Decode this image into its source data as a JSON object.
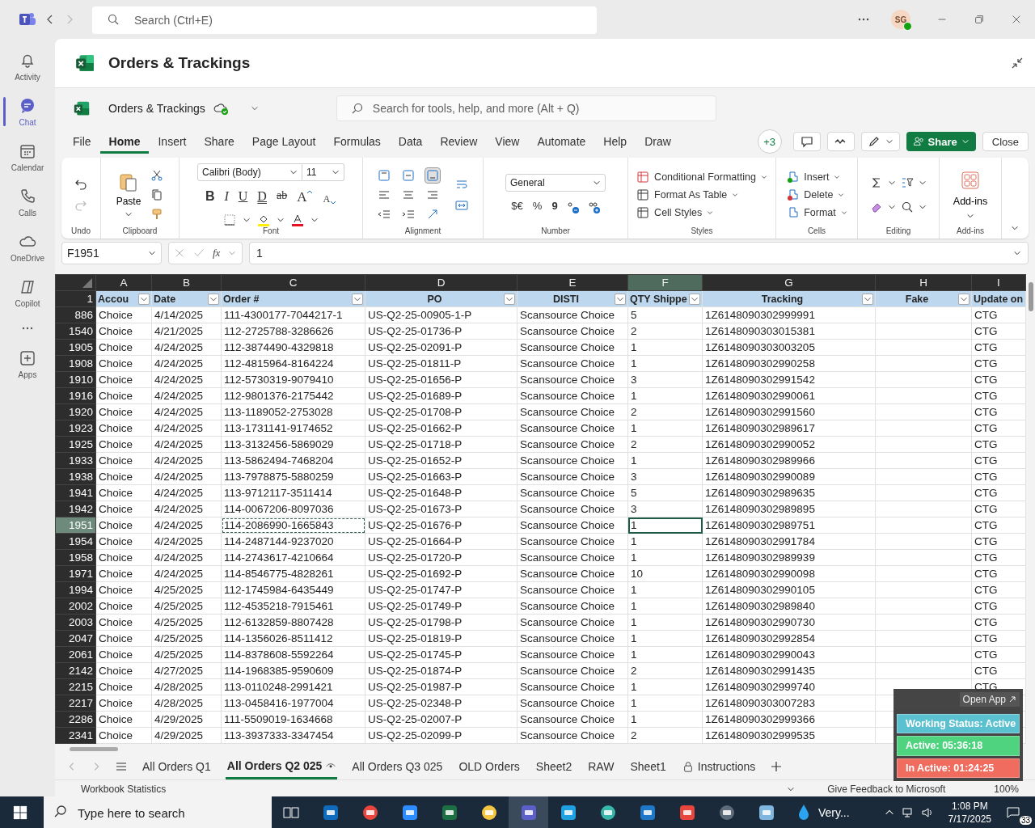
{
  "top_bar": {
    "search_placeholder": "Search (Ctrl+E)",
    "avatar_initials": "SG",
    "online": true
  },
  "sidebar": {
    "items": [
      {
        "label": "Activity",
        "selected": false
      },
      {
        "label": "Chat",
        "selected": true
      },
      {
        "label": "Calendar",
        "selected": false
      },
      {
        "label": "Calls",
        "selected": false
      },
      {
        "label": "OneDrive",
        "selected": false
      },
      {
        "label": "Copilot",
        "selected": false
      },
      {
        "label": "Apps",
        "selected": false
      }
    ]
  },
  "app_header": {
    "title": "Orders & Trackings"
  },
  "workbook": {
    "name": "Orders & Trackings",
    "search_placeholder": "Search for tools, help, and more (Alt + Q)"
  },
  "menu_tabs": [
    {
      "label": "File",
      "selected": false
    },
    {
      "label": "Home",
      "selected": true
    },
    {
      "label": "Insert",
      "selected": false
    },
    {
      "label": "Share",
      "selected": false
    },
    {
      "label": "Page Layout",
      "selected": false
    },
    {
      "label": "Formulas",
      "selected": false
    },
    {
      "label": "Data",
      "selected": false
    },
    {
      "label": "Review",
      "selected": false
    },
    {
      "label": "View",
      "selected": false
    },
    {
      "label": "Automate",
      "selected": false
    },
    {
      "label": "Help",
      "selected": false
    },
    {
      "label": "Draw",
      "selected": false
    }
  ],
  "collaborators": "+3",
  "share_button": "Share",
  "close_button": "Close",
  "ribbon": {
    "undo_label": "Undo",
    "paste": "Paste",
    "clipboard_label": "Clipboard",
    "font_name": "Calibri (Body)",
    "font_size": "11",
    "font_buttons": [
      {
        "text": "B",
        "kind": "bold"
      },
      {
        "text": "I",
        "kind": "italic"
      },
      {
        "text": "U",
        "kind": "underline"
      },
      {
        "text": "D",
        "kind": "double"
      },
      {
        "text": "ab",
        "kind": "strike"
      },
      {
        "text": "A",
        "kind": "grow"
      },
      {
        "text": "A",
        "kind": "shrink"
      }
    ],
    "font_label": "Font",
    "alignment_label": "Alignment",
    "number_format": "General",
    "currency": "$€",
    "percent": "%",
    "comma": "9",
    "number_label": "Number",
    "styles": [
      "Conditional Formatting",
      "Format As Table",
      "Cell Styles"
    ],
    "styles_label": "Styles",
    "cells": [
      "Insert",
      "Delete",
      "Format"
    ],
    "cells_label": "Cells",
    "editing_label": "Editing",
    "addins": "Add-ins",
    "addins_label": "Add-ins"
  },
  "formula_bar": {
    "name_box": "F1951",
    "fx": "fx",
    "value": "1"
  },
  "grid": {
    "columns": [
      {
        "letter": "A",
        "header": "Accou",
        "filter_button": true,
        "selected": false
      },
      {
        "letter": "B",
        "header": "Date",
        "filter_button": true,
        "selected": false
      },
      {
        "letter": "C",
        "header": "Order #",
        "filter_button": true,
        "selected": false
      },
      {
        "letter": "D",
        "header": "PO",
        "filter_button": true,
        "selected": false
      },
      {
        "letter": "E",
        "header": "DISTI",
        "filter_button": true,
        "selected": false
      },
      {
        "letter": "F",
        "header": "QTY Shippe",
        "filter_button": true,
        "selected": true
      },
      {
        "letter": "G",
        "header": "Tracking",
        "filter_button": true,
        "selected": false
      },
      {
        "letter": "H",
        "header": "Fake",
        "filter_button": true,
        "selected": false
      },
      {
        "letter": "I",
        "header": "Update on",
        "filter_button": false,
        "selected": false
      }
    ],
    "header_row_number": "1",
    "rows": [
      {
        "number": "886",
        "account": "Choice",
        "date": "4/14/2025",
        "order": "111-4300177-7044217-1",
        "po": "US-Q2-25-00905-1-P",
        "disti": "Scansource Choice",
        "qty": "5",
        "tracking": "1Z6148090302999991",
        "update_on": "CTG",
        "selected": false,
        "copied": false
      },
      {
        "number": "1540",
        "account": "Choice",
        "date": "4/21/2025",
        "order": "112-2725788-3286626",
        "po": "US-Q2-25-01736-P",
        "disti": "Scansource Choice",
        "qty": "2",
        "tracking": "1Z6148090303015381",
        "update_on": "CTG",
        "selected": false,
        "copied": false
      },
      {
        "number": "1905",
        "account": "Choice",
        "date": "4/24/2025",
        "order": "112-3874490-4329818",
        "po": "US-Q2-25-02091-P",
        "disti": "Scansource Choice",
        "qty": "1",
        "tracking": "1Z6148090303003205",
        "update_on": "CTG",
        "selected": false,
        "copied": false
      },
      {
        "number": "1908",
        "account": "Choice",
        "date": "4/24/2025",
        "order": "112-4815964-8164224",
        "po": "US-Q2-25-01811-P",
        "disti": "Scansource Choice",
        "qty": "1",
        "tracking": "1Z6148090302990258",
        "update_on": "CTG",
        "selected": false,
        "copied": false
      },
      {
        "number": "1910",
        "account": "Choice",
        "date": "4/24/2025",
        "order": "112-5730319-9079410",
        "po": "US-Q2-25-01656-P",
        "disti": "Scansource Choice",
        "qty": "3",
        "tracking": "1Z6148090302991542",
        "update_on": "CTG",
        "selected": false,
        "copied": false
      },
      {
        "number": "1916",
        "account": "Choice",
        "date": "4/24/2025",
        "order": "112-9801376-2175442",
        "po": "US-Q2-25-01689-P",
        "disti": "Scansource Choice",
        "qty": "1",
        "tracking": "1Z6148090302990061",
        "update_on": "CTG",
        "selected": false,
        "copied": false
      },
      {
        "number": "1920",
        "account": "Choice",
        "date": "4/24/2025",
        "order": "113-1189052-2753028",
        "po": "US-Q2-25-01708-P",
        "disti": "Scansource Choice",
        "qty": "2",
        "tracking": "1Z6148090302991560",
        "update_on": "CTG",
        "selected": false,
        "copied": false
      },
      {
        "number": "1923",
        "account": "Choice",
        "date": "4/24/2025",
        "order": "113-1731141-9174652",
        "po": "US-Q2-25-01662-P",
        "disti": "Scansource Choice",
        "qty": "1",
        "tracking": "1Z6148090302989617",
        "update_on": "CTG",
        "selected": false,
        "copied": false
      },
      {
        "number": "1925",
        "account": "Choice",
        "date": "4/24/2025",
        "order": "113-3132456-5869029",
        "po": "US-Q2-25-01718-P",
        "disti": "Scansource Choice",
        "qty": "2",
        "tracking": "1Z6148090302990052",
        "update_on": "CTG",
        "selected": false,
        "copied": false
      },
      {
        "number": "1933",
        "account": "Choice",
        "date": "4/24/2025",
        "order": "113-5862494-7468204",
        "po": "US-Q2-25-01652-P",
        "disti": "Scansource Choice",
        "qty": "1",
        "tracking": "1Z6148090302989966",
        "update_on": "CTG",
        "selected": false,
        "copied": false
      },
      {
        "number": "1938",
        "account": "Choice",
        "date": "4/24/2025",
        "order": "113-7978875-5880259",
        "po": "US-Q2-25-01663-P",
        "disti": "Scansource Choice",
        "qty": "3",
        "tracking": "1Z6148090302990089",
        "update_on": "CTG",
        "selected": false,
        "copied": false
      },
      {
        "number": "1941",
        "account": "Choice",
        "date": "4/24/2025",
        "order": "113-9712117-3511414",
        "po": "US-Q2-25-01648-P",
        "disti": "Scansource Choice",
        "qty": "5",
        "tracking": "1Z6148090302989635",
        "update_on": "CTG",
        "selected": false,
        "copied": false
      },
      {
        "number": "1942",
        "account": "Choice",
        "date": "4/24/2025",
        "order": "114-0067206-8097036",
        "po": "US-Q2-25-01673-P",
        "disti": "Scansource Choice",
        "qty": "3",
        "tracking": "1Z6148090302989895",
        "update_on": "CTG",
        "selected": false,
        "copied": false
      },
      {
        "number": "1951",
        "account": "Choice",
        "date": "4/24/2025",
        "order": "114-2086990-1665843",
        "po": "US-Q2-25-01676-P",
        "disti": "Scansource Choice",
        "qty": "1",
        "tracking": "1Z6148090302989751",
        "update_on": "CTG",
        "selected": true,
        "copied": true
      },
      {
        "number": "1954",
        "account": "Choice",
        "date": "4/24/2025",
        "order": "114-2487144-9237020",
        "po": "US-Q2-25-01664-P",
        "disti": "Scansource Choice",
        "qty": "1",
        "tracking": "1Z6148090302991784",
        "update_on": "CTG",
        "selected": false,
        "copied": false
      },
      {
        "number": "1958",
        "account": "Choice",
        "date": "4/24/2025",
        "order": "114-2743617-4210664",
        "po": "US-Q2-25-01720-P",
        "disti": "Scansource Choice",
        "qty": "1",
        "tracking": "1Z6148090302989939",
        "update_on": "CTG",
        "selected": false,
        "copied": false
      },
      {
        "number": "1971",
        "account": "Choice",
        "date": "4/24/2025",
        "order": "114-8546775-4828261",
        "po": "US-Q2-25-01692-P",
        "disti": "Scansource Choice",
        "qty": "10",
        "tracking": "1Z6148090302990098",
        "update_on": "CTG",
        "selected": false,
        "copied": false
      },
      {
        "number": "1994",
        "account": "Choice",
        "date": "4/25/2025",
        "order": "112-1745984-6435449",
        "po": "US-Q2-25-01747-P",
        "disti": "Scansource Choice",
        "qty": "1",
        "tracking": "1Z6148090302990105",
        "update_on": "CTG",
        "selected": false,
        "copied": false
      },
      {
        "number": "2002",
        "account": "Choice",
        "date": "4/25/2025",
        "order": "112-4535218-7915461",
        "po": "US-Q2-25-01749-P",
        "disti": "Scansource Choice",
        "qty": "1",
        "tracking": "1Z6148090302989840",
        "update_on": "CTG",
        "selected": false,
        "copied": false
      },
      {
        "number": "2003",
        "account": "Choice",
        "date": "4/25/2025",
        "order": "112-6132859-8807428",
        "po": "US-Q2-25-01798-P",
        "disti": "Scansource Choice",
        "qty": "1",
        "tracking": "1Z6148090302990730",
        "update_on": "CTG",
        "selected": false,
        "copied": false
      },
      {
        "number": "2047",
        "account": "Choice",
        "date": "4/25/2025",
        "order": "114-1356026-8511412",
        "po": "US-Q2-25-01819-P",
        "disti": "Scansource Choice",
        "qty": "1",
        "tracking": "1Z6148090302992854",
        "update_on": "CTG",
        "selected": false,
        "copied": false
      },
      {
        "number": "2061",
        "account": "Choice",
        "date": "4/25/2025",
        "order": "114-8378608-5592264",
        "po": "US-Q2-25-01745-P",
        "disti": "Scansource Choice",
        "qty": "1",
        "tracking": "1Z6148090302990043",
        "update_on": "CTG",
        "selected": false,
        "copied": false
      },
      {
        "number": "2142",
        "account": "Choice",
        "date": "4/27/2025",
        "order": "114-1968385-9590609",
        "po": "US-Q2-25-01874-P",
        "disti": "Scansource Choice",
        "qty": "2",
        "tracking": "1Z6148090302991435",
        "update_on": "CTG",
        "selected": false,
        "copied": false
      },
      {
        "number": "2215",
        "account": "Choice",
        "date": "4/28/2025",
        "order": "113-0110248-2991421",
        "po": "US-Q2-25-01987-P",
        "disti": "Scansource Choice",
        "qty": "1",
        "tracking": "1Z6148090302999740",
        "update_on": "CTG",
        "selected": false,
        "copied": false
      },
      {
        "number": "2217",
        "account": "Choice",
        "date": "4/28/2025",
        "order": "113-0458416-1977004",
        "po": "US-Q2-25-02348-P",
        "disti": "Scansource Choice",
        "qty": "1",
        "tracking": "1Z6148090303007283",
        "selected": false,
        "copied": false
      },
      {
        "number": "2286",
        "account": "Choice",
        "date": "4/29/2025",
        "order": "111-5509019-1634668",
        "po": "US-Q2-25-02007-P",
        "disti": "Scansource Choice",
        "qty": "1",
        "tracking": "1Z6148090302999366",
        "selected": false,
        "copied": false
      },
      {
        "number": "2341",
        "account": "Choice",
        "date": "4/29/2025",
        "order": "113-3937333-3347454",
        "po": "US-Q2-25-02099-P",
        "disti": "Scansource Choice",
        "qty": "2",
        "tracking": "1Z6148090302999535",
        "selected": false,
        "copied": false
      }
    ]
  },
  "sheet_tabs": [
    {
      "label": "All Orders Q1",
      "selected": false,
      "kind": "plain"
    },
    {
      "label": "All Orders Q2 025",
      "selected": true,
      "kind": "watched"
    },
    {
      "label": "All Orders Q3 025",
      "selected": false,
      "kind": "plain"
    },
    {
      "label": "OLD Orders",
      "selected": false,
      "kind": "plain"
    },
    {
      "label": "Sheet2",
      "selected": false,
      "kind": "plain"
    },
    {
      "label": "RAW",
      "selected": false,
      "kind": "plain"
    },
    {
      "label": "Sheet1",
      "selected": false,
      "kind": "plain"
    },
    {
      "label": "Instructions",
      "selected": false,
      "kind": "locked"
    }
  ],
  "status_bar": {
    "left": "Workbook Statistics",
    "feedback": "Give Feedback to Microsoft",
    "zoom": "100%"
  },
  "tracker_widget": {
    "open_app": "Open App",
    "statuses": [
      {
        "text": "Working Status: Active",
        "color": "#5bc0cf"
      },
      {
        "text": "Active: 05:36:18",
        "color": "#4fd37f"
      },
      {
        "text": "In Active: 01:24:25",
        "color": "#ef6c5f"
      }
    ]
  },
  "taskbar": {
    "search_placeholder": "Type here to search",
    "weather": "Very...",
    "time": "1:08 PM",
    "date": "7/17/2025",
    "notifications": "33"
  }
}
